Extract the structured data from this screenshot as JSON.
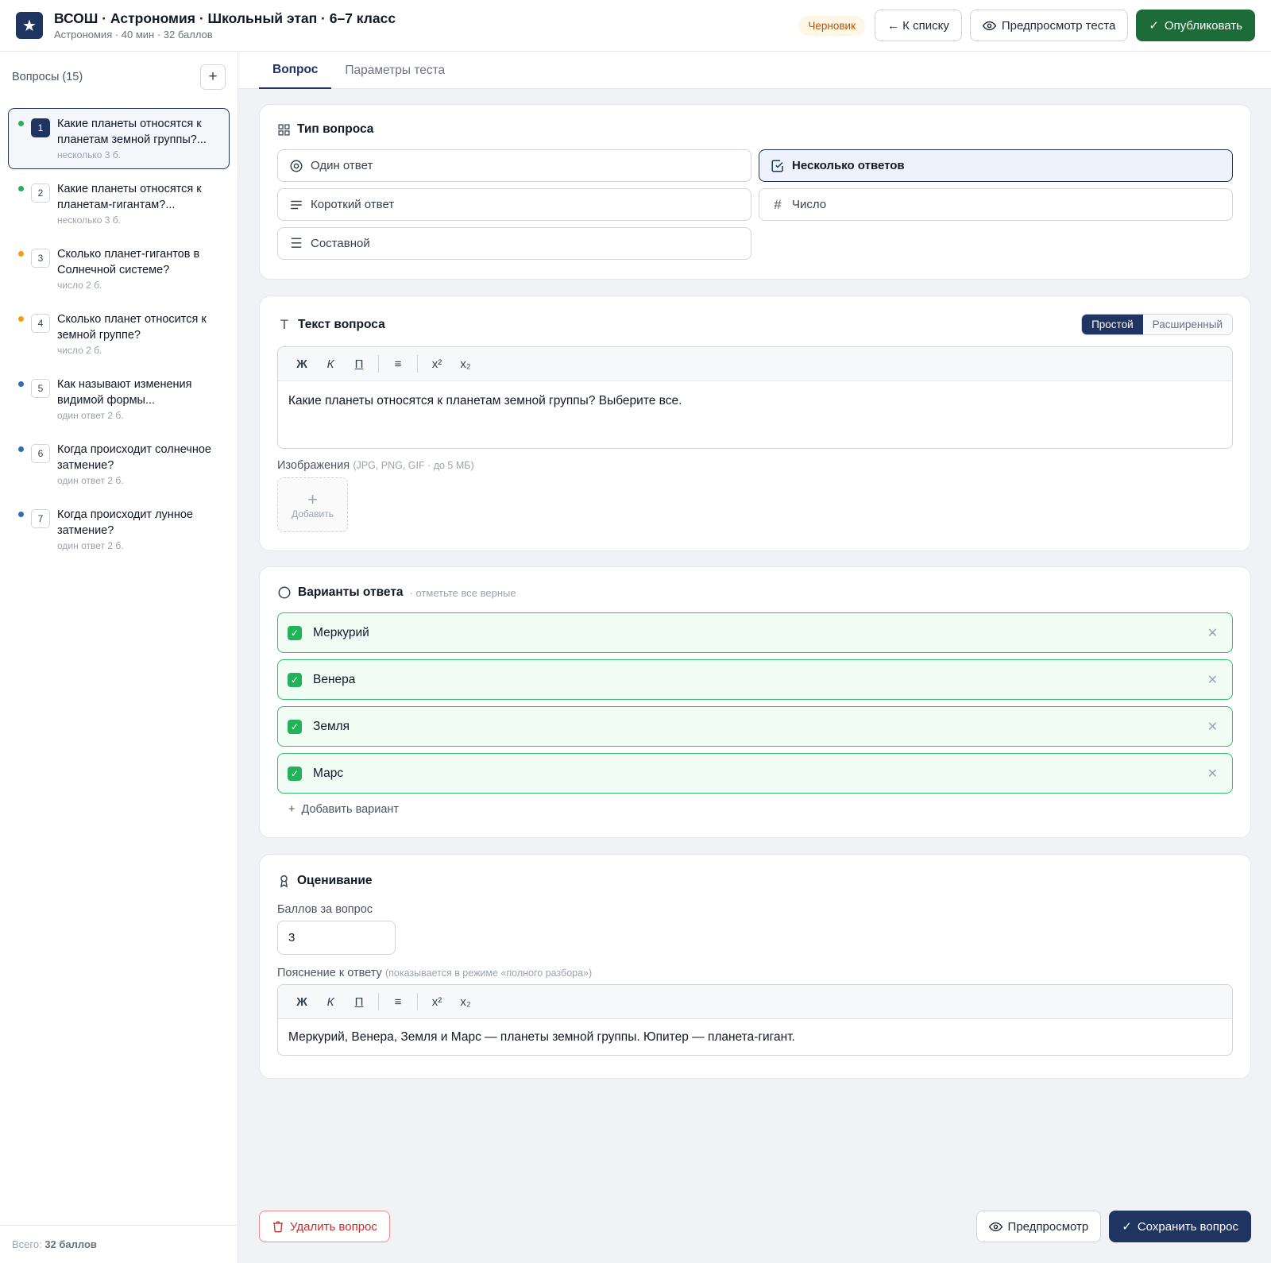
{
  "header": {
    "logo_icon": "star-icon",
    "title": "ВСОШ · Астрономия · Школьный этап · 6–7 класс",
    "subtitle": "Астрономия · 40 мин · 32 баллов",
    "status_badge": "Черновик",
    "back_label": "← К списку",
    "preview_test_label": "Предпросмотр теста",
    "publish_label": "Опубликовать"
  },
  "sidebar": {
    "title": "Вопросы (15)",
    "add_icon": "plus-icon",
    "items": [
      {
        "num": "1",
        "text": "Какие планеты относятся к планетам земной группы?...",
        "meta": "несколько  3 б.",
        "color": "#22b35a",
        "active": true
      },
      {
        "num": "2",
        "text": "Какие планеты относятся к планетам-гигантам?...",
        "meta": "несколько  3 б.",
        "color": "#22b35a"
      },
      {
        "num": "3",
        "text": "Сколько планет-гигантов в Солнечной системе?",
        "meta": "число  2 б.",
        "color": "#f59e0b"
      },
      {
        "num": "4",
        "text": "Сколько планет относится к земной группе?",
        "meta": "число  2 б.",
        "color": "#f59e0b"
      },
      {
        "num": "5",
        "text": "Как называют изменения видимой формы...",
        "meta": "один ответ  2 б.",
        "color": "#2f6db5"
      },
      {
        "num": "6",
        "text": "Когда происходит солнечное затмение?",
        "meta": "один ответ  2 б.",
        "color": "#2f6db5"
      },
      {
        "num": "7",
        "text": "Когда происходит лунное затмение?",
        "meta": "один ответ  2 б.",
        "color": "#2f6db5"
      }
    ],
    "footer_prefix": "Всего: ",
    "footer_total": "32 баллов"
  },
  "tabs": [
    {
      "label": "Вопрос",
      "active": true
    },
    {
      "label": "Параметры теста"
    }
  ],
  "question_type": {
    "title": "Тип вопроса",
    "options": [
      {
        "label": "Один ответ",
        "icon": "radio-icon"
      },
      {
        "label": "Несколько ответов",
        "icon": "checkbox-icon",
        "selected": true
      },
      {
        "label": "Короткий ответ",
        "icon": "lines-icon"
      },
      {
        "label": "Число",
        "icon": "hash-icon"
      },
      {
        "label": "Составной",
        "icon": "list-icon"
      }
    ]
  },
  "question_text": {
    "title": "Текст вопроса",
    "mode_simple": "Простой",
    "mode_extended": "Расширенный",
    "toolbar": {
      "bold": "Ж",
      "italic": "К",
      "underline": "П",
      "list": "≡",
      "sup": "x²",
      "sub": "x₂"
    },
    "content": "Какие планеты относятся к планетам земной группы? Выберите все.",
    "images_label": "Изображения",
    "images_hint": "(JPG, PNG, GIF · до 5 МБ)",
    "upload_label": "Добавить"
  },
  "answers": {
    "title": "Варианты ответа",
    "hint": "· отметьте все верные",
    "options": [
      "Меркурий",
      "Венера",
      "Земля",
      "Марс"
    ],
    "add_label": "Добавить вариант"
  },
  "grading": {
    "title": "Оценивание",
    "points_label": "Баллов за вопрос",
    "points_value": "3",
    "explanation_label": "Пояснение к ответу",
    "explanation_hint": "(показывается в режиме «полного разбора»)",
    "explanation_text": "Меркурий, Венера, Земля и Марс — планеты земной группы. Юпитер — планета-гигант."
  },
  "footer": {
    "delete_label": "Удалить вопрос",
    "preview_label": "Предпросмотр",
    "save_label": "Сохранить вопрос"
  },
  "colors": {
    "navy": "#1f3460",
    "green": "#1e6b3a",
    "correct": "#22b35a",
    "danger": "#c53030"
  }
}
